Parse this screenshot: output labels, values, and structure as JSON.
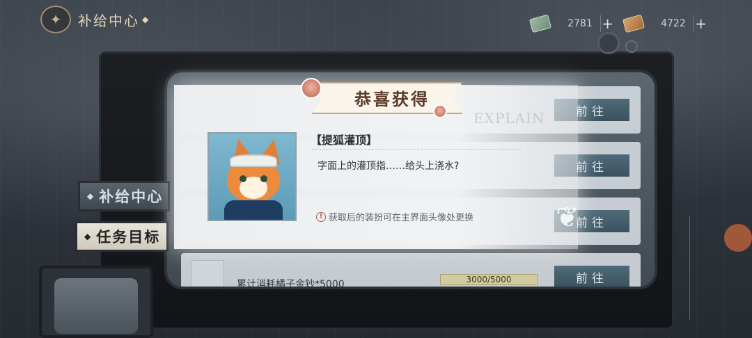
{
  "header": {
    "title": "补给中心",
    "emblem_icon": "butterfly-emblem-icon"
  },
  "currency": [
    {
      "icon": "cash-icon",
      "value": "2781",
      "plus": "+"
    },
    {
      "icon": "ticket-icon",
      "value": "4722",
      "plus": "+"
    }
  ],
  "side_tabs": {
    "supply": "补给中心",
    "tasks": "任务目标"
  },
  "background_list": {
    "go_label": "前往",
    "row4_desc": "累计消耗橘子金钞*5000",
    "row4_progress": "3000/5000"
  },
  "popup": {
    "banner": "恭喜获得",
    "watermark": "EXPLAIN",
    "reward_name": "【提狐灌顶】",
    "reward_desc": "字面上的灌顶指……给头上浇水?",
    "note": "获取后的装扮可在主界面头像处更换",
    "note_icon": "warning-icon",
    "portrait": "fox-avatar-icon"
  },
  "colors": {
    "accent_go": "#4f6a78",
    "banner_text": "#5b3b2a",
    "warning": "#b15a4b"
  }
}
